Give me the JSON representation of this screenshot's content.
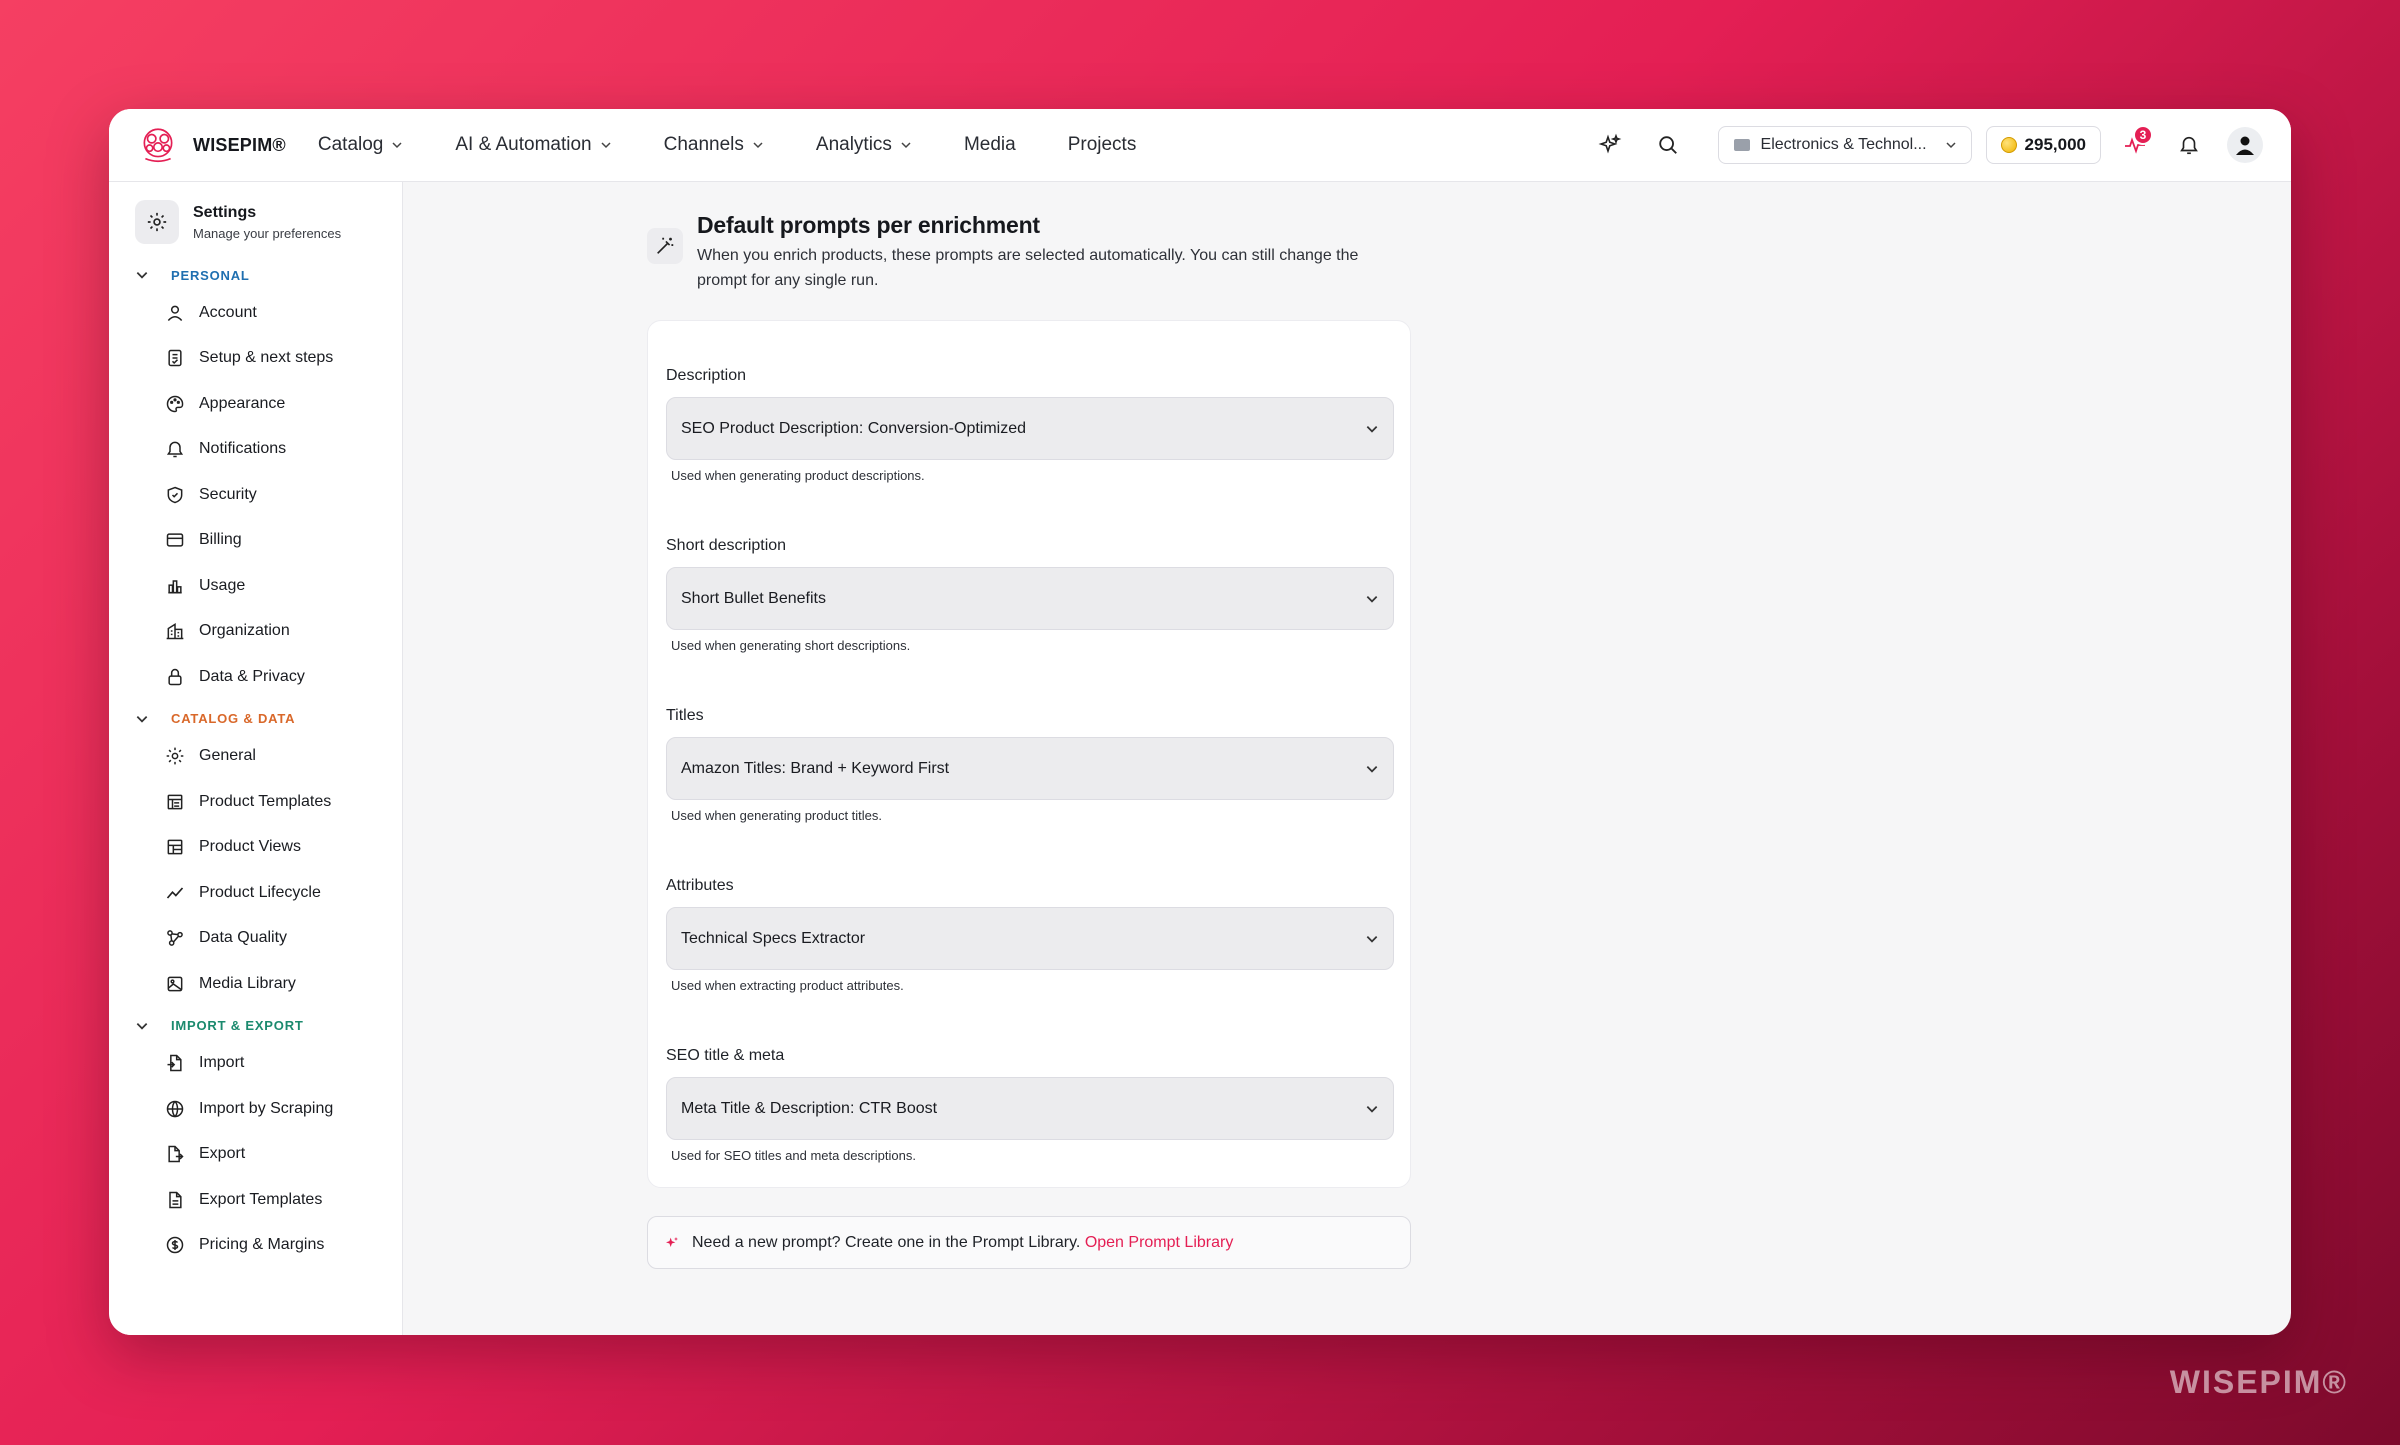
{
  "brand": {
    "name": "WISEPIM®"
  },
  "nav": {
    "catalog": "Catalog",
    "ai": "AI & Automation",
    "channels": "Channels",
    "analytics": "Analytics",
    "media": "Media",
    "projects": "Projects"
  },
  "topbar": {
    "workspace": "Electronics & Technol...",
    "credits": "295,000",
    "activity_badge": "3"
  },
  "sidebar": {
    "title": "Settings",
    "subtitle": "Manage your preferences",
    "sections": {
      "personal": {
        "label": "PERSONAL",
        "items": [
          "Account",
          "Setup & next steps",
          "Appearance",
          "Notifications",
          "Security",
          "Billing",
          "Usage",
          "Organization",
          "Data & Privacy"
        ]
      },
      "catalog": {
        "label": "CATALOG & DATA",
        "items": [
          "General",
          "Product Templates",
          "Product Views",
          "Product Lifecycle",
          "Data Quality",
          "Media Library"
        ]
      },
      "import": {
        "label": "IMPORT & EXPORT",
        "items": [
          "Import",
          "Import by Scraping",
          "Export",
          "Export Templates",
          "Pricing & Margins"
        ]
      }
    }
  },
  "page": {
    "title": "Default prompts per enrichment",
    "description": "When you enrich products, these prompts are selected automatically. You can still change the prompt for any single run."
  },
  "fields": [
    {
      "label": "Description",
      "value": "SEO Product Description: Conversion-Optimized",
      "help": "Used when generating product descriptions."
    },
    {
      "label": "Short description",
      "value": "Short Bullet Benefits",
      "help": "Used when generating short descriptions."
    },
    {
      "label": "Titles",
      "value": "Amazon Titles: Brand + Keyword First",
      "help": "Used when generating product titles."
    },
    {
      "label": "Attributes",
      "value": "Technical Specs Extractor",
      "help": "Used when extracting product attributes."
    },
    {
      "label": "SEO title & meta",
      "value": "Meta Title & Description: CTR Boost",
      "help": "Used for SEO titles and meta descriptions."
    }
  ],
  "tip": {
    "text": "Need a new prompt? Create one in the Prompt Library.",
    "link": "Open Prompt Library"
  },
  "watermark": "WISEPIM®",
  "colors": {
    "accent": "#e41f54",
    "personal": "#1f6fb0",
    "catalog": "#d9682a",
    "import": "#1b8a6e"
  }
}
